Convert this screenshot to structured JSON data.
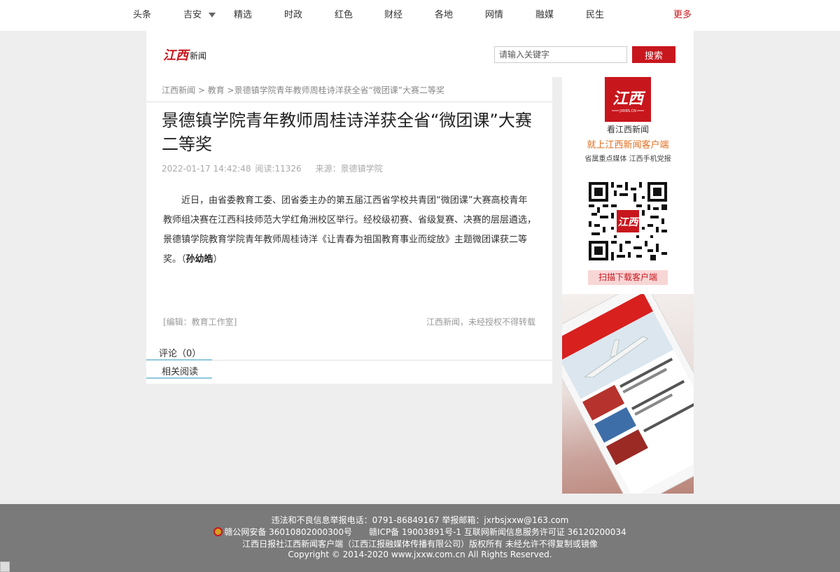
{
  "nav": {
    "items": [
      "头条",
      "吉安",
      "精选",
      "时政",
      "红色",
      "财经",
      "各地",
      "网情",
      "融媒",
      "民生"
    ],
    "more": "更多"
  },
  "header": {
    "logo_text": "江西新闻",
    "search_placeholder": "请输入关键字",
    "search_button": "搜索"
  },
  "article": {
    "breadcrumb": {
      "home": "江西新闻",
      "sep1": " > ",
      "section": "教育",
      "sep2": " >",
      "current": "景德镇学院青年教师周桂诗洋获全省“微团课”大赛二等奖"
    },
    "title": "景德镇学院青年教师周桂诗洋获全省“微团课”大赛二等奖",
    "datetime": "2022-01-17 14:42:48",
    "reads": "阅读:11326",
    "source": "来源：景德镇学院",
    "body": "近日，由省委教育工委、团省委主办的第五届江西省学校共青团“微团课”大赛高校青年教师组决赛在江西科技师范大学红角洲校区举行。经校级初赛、省级复赛、决赛的层层遴选，景德镇学院教育学院青年教师周桂诗洋《让青春为祖国教育事业而绽放》主题微团课获二等奖。（",
    "author": "孙幼皓",
    "body_end": "）",
    "editor": "[编辑：教育工作室]",
    "rights": "江西新闻，未经授权不得转载",
    "comment_tab": "评论（0）",
    "related_tab": "相关阅读"
  },
  "sidebar": {
    "logo_text": "江西",
    "logo_sub": "JXRBS.CN",
    "caption1": "看江西新闻",
    "caption2": "就上江西新闻客户端",
    "caption3": "省属重点媒体 江西手机党报",
    "qr_center_text": "江西",
    "download_button": "扫描下载客户端"
  },
  "footer": {
    "line1": "违法和不良信息举报电话：0791-86849167  举报邮箱：jxrbsjxxw@163.com",
    "police_record": "赣公网安备 36010802000300号",
    "icp": "赣ICP备 19003891号-1 互联网新闻信息服务许可证 36120200034",
    "line3": "江西日报社江西新闻客户端（江西江报融媒体传播有限公司）版权所有 未经允许不得复制或镜像",
    "line4": "Copyright © 2014-2020 www.jxxw.com.cn All Rights Reserved."
  },
  "colors": {
    "brand_red": "#c8161d",
    "accent_orange": "#e06d1e",
    "footer_gray": "#7a7a7a",
    "tab_underline": "#90c8dc"
  }
}
